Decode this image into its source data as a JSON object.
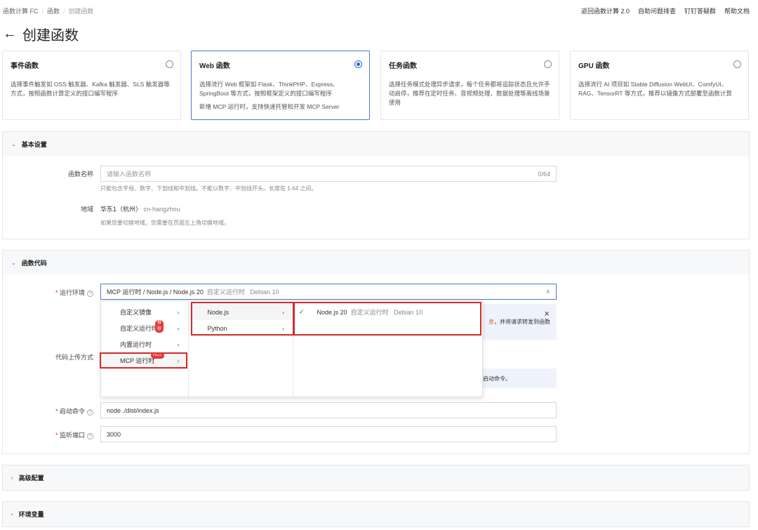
{
  "breadcrumb": [
    "函数计算 FC",
    "函数",
    "创建函数"
  ],
  "top_links": [
    "返回函数计算 2.0",
    "自助问题排查",
    "钉钉答疑群",
    "帮助文档"
  ],
  "page_title": "创建函数",
  "cards": [
    {
      "title": "事件函数",
      "desc": [
        "选择事件触发如 OSS 触发器、Kafka 触发器、SLS 触发器等方式，按照函数计算定义的接口编写程序"
      ],
      "selected": false
    },
    {
      "title": "Web 函数",
      "desc": [
        "选择流行 Web 框架如 Flask、ThinkPHP、Express、SpringBoot 等方式，按照框架定义的接口编写程序",
        "新增 MCP 运行时，支持快速托管和开发 MCP Server"
      ],
      "selected": true
    },
    {
      "title": "任务函数",
      "desc": [
        "选择任务模式处理异步请求，每个任务都将追踪状态且允许手动启停，推荐在定时任务、音视频处理、数据处理等离线场景使用"
      ],
      "selected": false
    },
    {
      "title": "GPU 函数",
      "desc": [
        "选择流行 AI 项目如 Stable Diffusion WebUI、ComfyUI、RAG、TensorRT 等方式，推荐以镜像方式部署至函数计算"
      ],
      "selected": false
    }
  ],
  "basic": {
    "header": "基本设置",
    "name_label": "函数名称",
    "name_placeholder": "请输入函数名称",
    "name_count": "0/64",
    "name_help": "只能包含字母、数字、下划线和中划线。不能以数字、中划线开头。长度在 1-64 之间。",
    "region_label": "地域",
    "region_value": "华东1（杭州）",
    "region_code": "cn-hangzhou",
    "region_help": "如果您要切换地域，您需要在页面左上角切换地域。"
  },
  "code": {
    "header": "函数代码",
    "runtime_label": "运行环境",
    "runtime_value": "MCP 运行时 / Node.js / Node.js 20",
    "runtime_tag1": "自定义运行时",
    "runtime_tag2": "Debian 10",
    "upload_label": "代码上传方式",
    "alert1_prefix": "息",
    "alert1_text": "，并将请求转发到函数",
    "alert2_text": "启动命令。",
    "start_label": "启动命令",
    "start_value": "node ./dist/index.js",
    "port_label": "监听端口",
    "port_value": "3000",
    "menu": {
      "col1": [
        {
          "label": "自定义镜像"
        },
        {
          "label": "自定义运行时",
          "badge": "推荐"
        },
        {
          "label": "内置运行时"
        },
        {
          "label": "MCP 运行时",
          "badge": "HOT"
        }
      ],
      "col2": [
        "Node.js",
        "Python"
      ],
      "col3": {
        "label": "Node.js 20",
        "tag1": "自定义运行时",
        "tag2": "Debian 10"
      }
    }
  },
  "advanced": {
    "header": "高级配置"
  },
  "env": {
    "header": "环境变量"
  },
  "colors": {
    "accent": "#2a64d6",
    "highlight": "#d42a2a",
    "badge": "#e8393a"
  }
}
